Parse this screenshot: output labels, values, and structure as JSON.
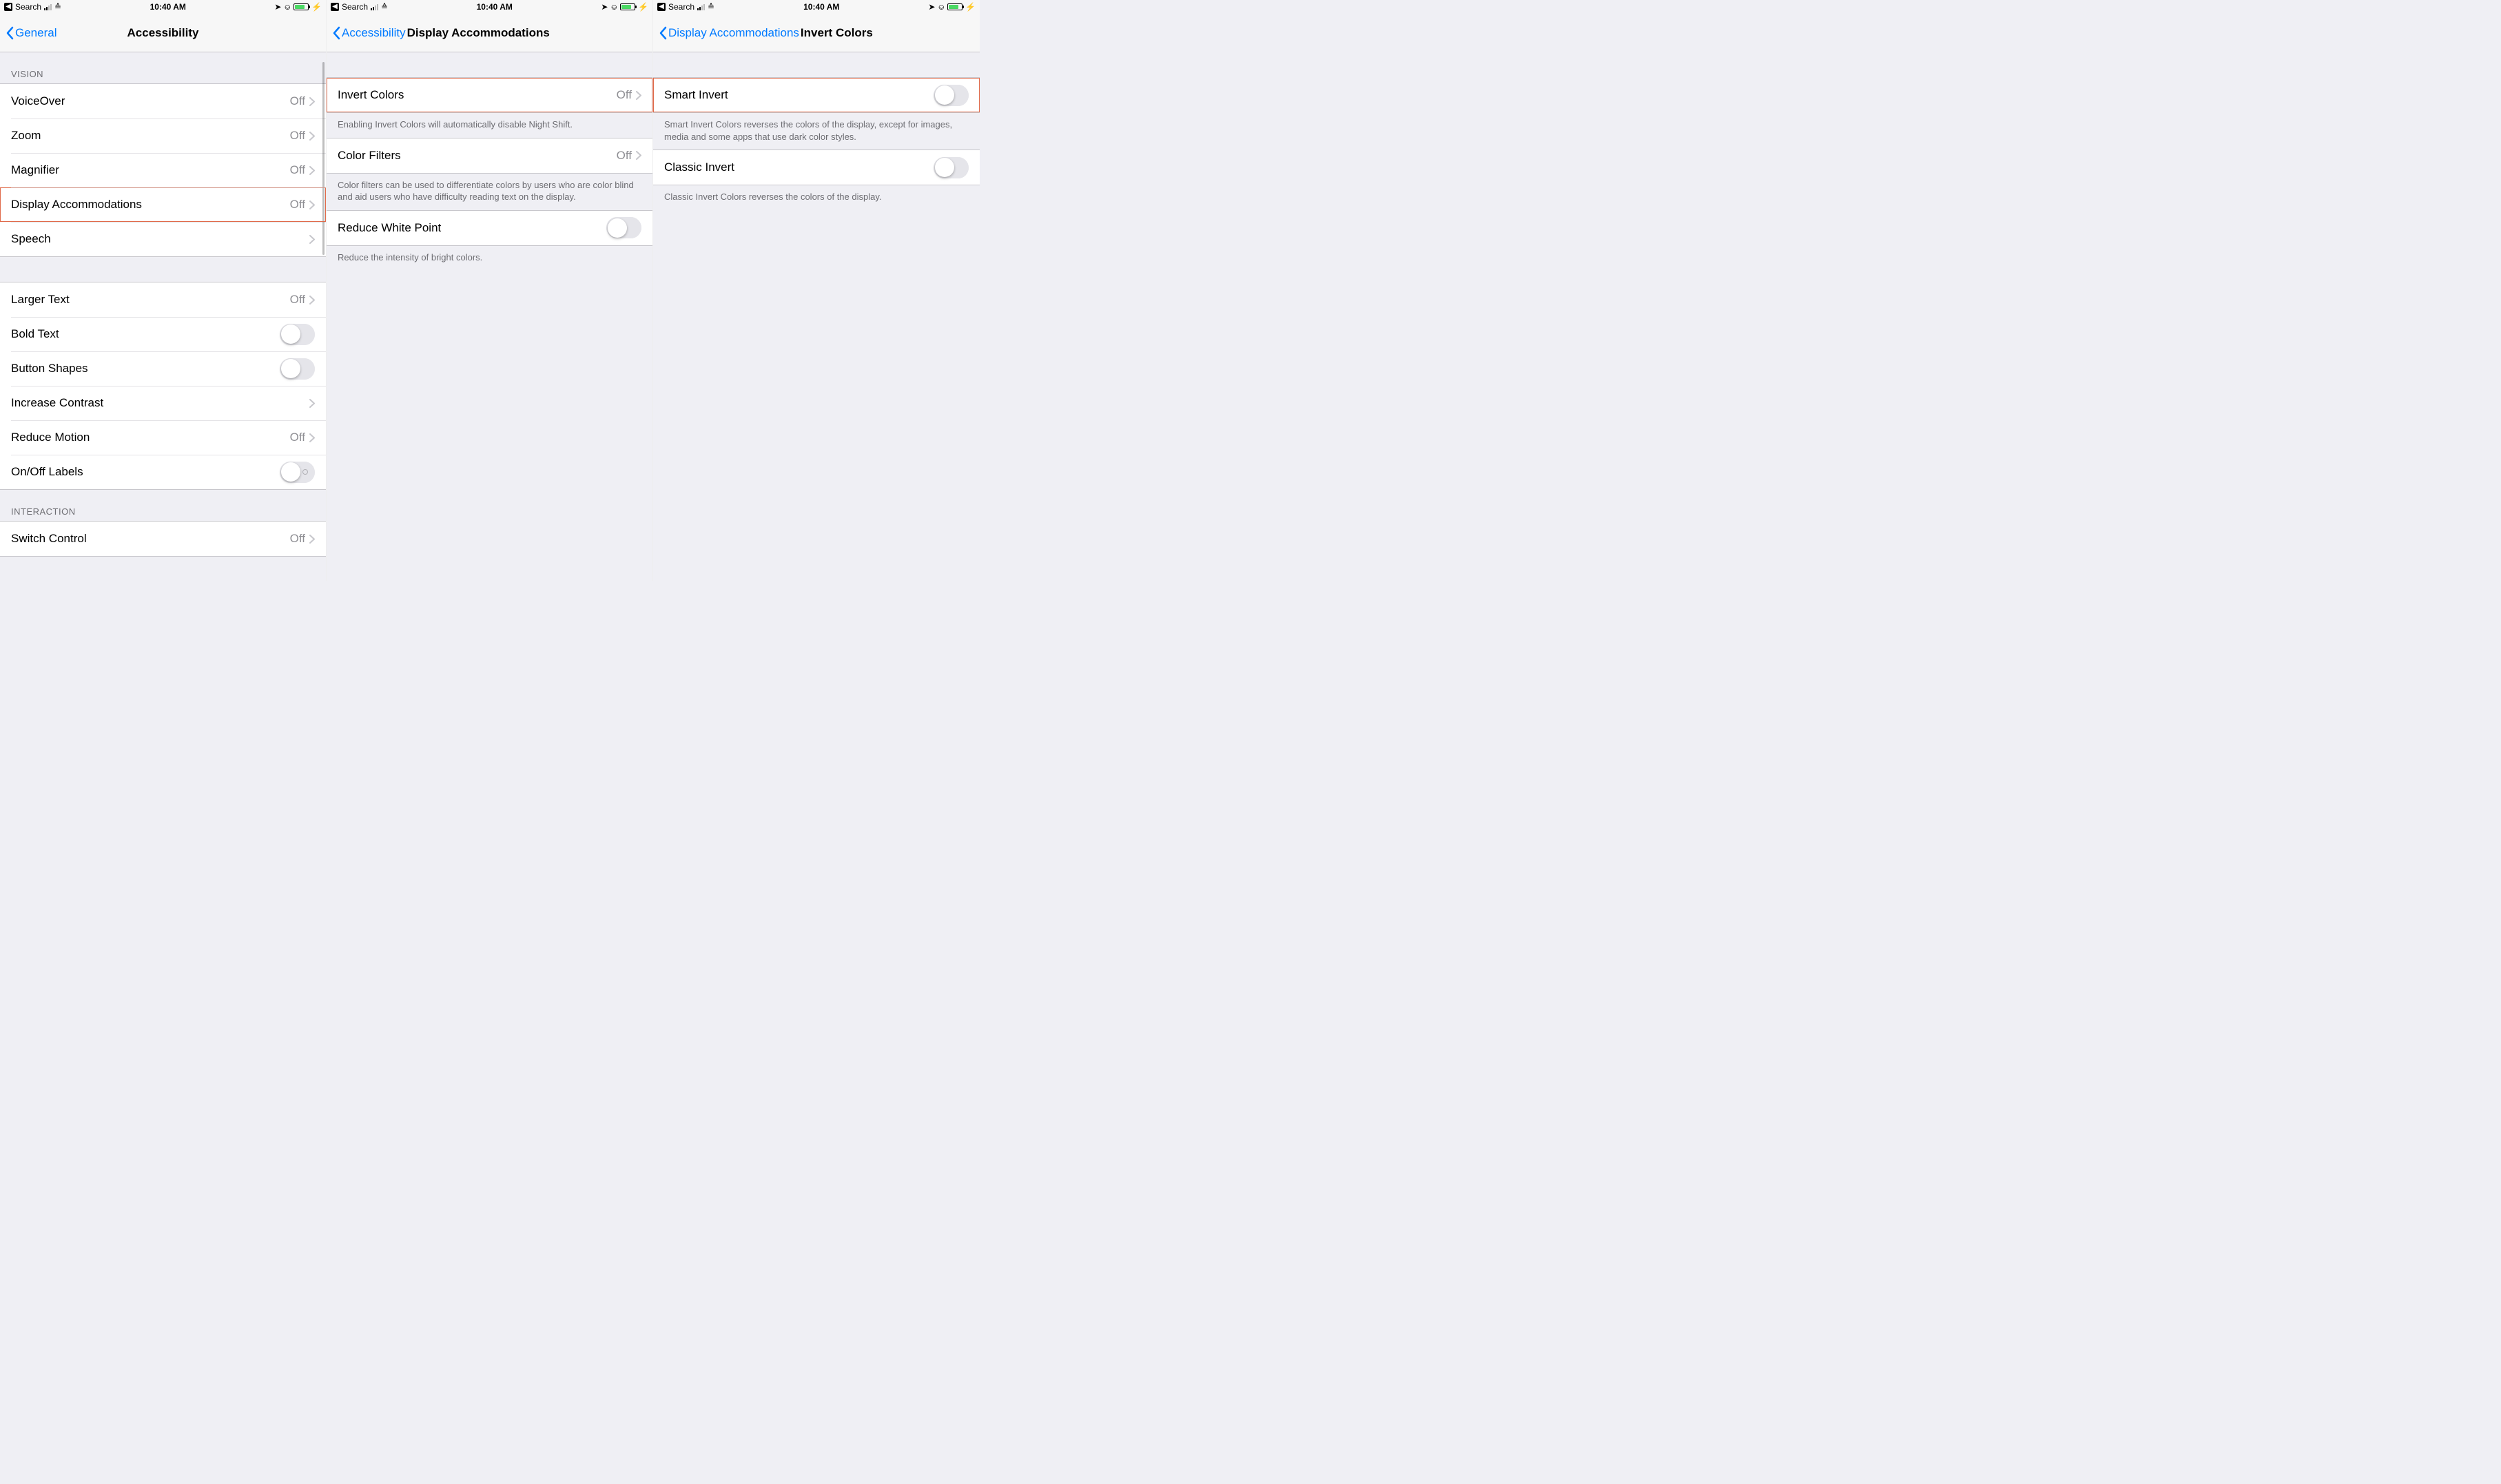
{
  "status": {
    "back_app": "Search",
    "time": "10:40 AM"
  },
  "screen1": {
    "back": "General",
    "title": "Accessibility",
    "header_vision": "VISION",
    "header_interaction": "INTERACTION",
    "rows": {
      "voiceover": {
        "label": "VoiceOver",
        "value": "Off"
      },
      "zoom": {
        "label": "Zoom",
        "value": "Off"
      },
      "magnifier": {
        "label": "Magnifier",
        "value": "Off"
      },
      "display_accommodations": {
        "label": "Display Accommodations",
        "value": "Off"
      },
      "speech": {
        "label": "Speech"
      },
      "larger_text": {
        "label": "Larger Text",
        "value": "Off"
      },
      "bold_text": {
        "label": "Bold Text"
      },
      "button_shapes": {
        "label": "Button Shapes"
      },
      "increase_contrast": {
        "label": "Increase Contrast"
      },
      "reduce_motion": {
        "label": "Reduce Motion",
        "value": "Off"
      },
      "on_off_labels": {
        "label": "On/Off Labels"
      },
      "switch_control": {
        "label": "Switch Control",
        "value": "Off"
      }
    }
  },
  "screen2": {
    "back": "Accessibility",
    "title": "Display Accommodations",
    "rows": {
      "invert_colors": {
        "label": "Invert Colors",
        "value": "Off"
      },
      "color_filters": {
        "label": "Color Filters",
        "value": "Off"
      },
      "reduce_white_point": {
        "label": "Reduce White Point"
      }
    },
    "footers": {
      "invert": "Enabling Invert Colors will automatically disable Night Shift.",
      "filters": "Color filters can be used to differentiate colors by users who are color blind and aid users who have difficulty reading text on the display.",
      "white_point": "Reduce the intensity of bright colors."
    }
  },
  "screen3": {
    "back": "Display Accommodations",
    "title": "Invert Colors",
    "rows": {
      "smart_invert": {
        "label": "Smart Invert"
      },
      "classic_invert": {
        "label": "Classic Invert"
      }
    },
    "footers": {
      "smart": "Smart Invert Colors reverses the colors of the display, except for images, media and some apps that use dark color styles.",
      "classic": "Classic Invert Colors reverses the colors of the display."
    }
  }
}
